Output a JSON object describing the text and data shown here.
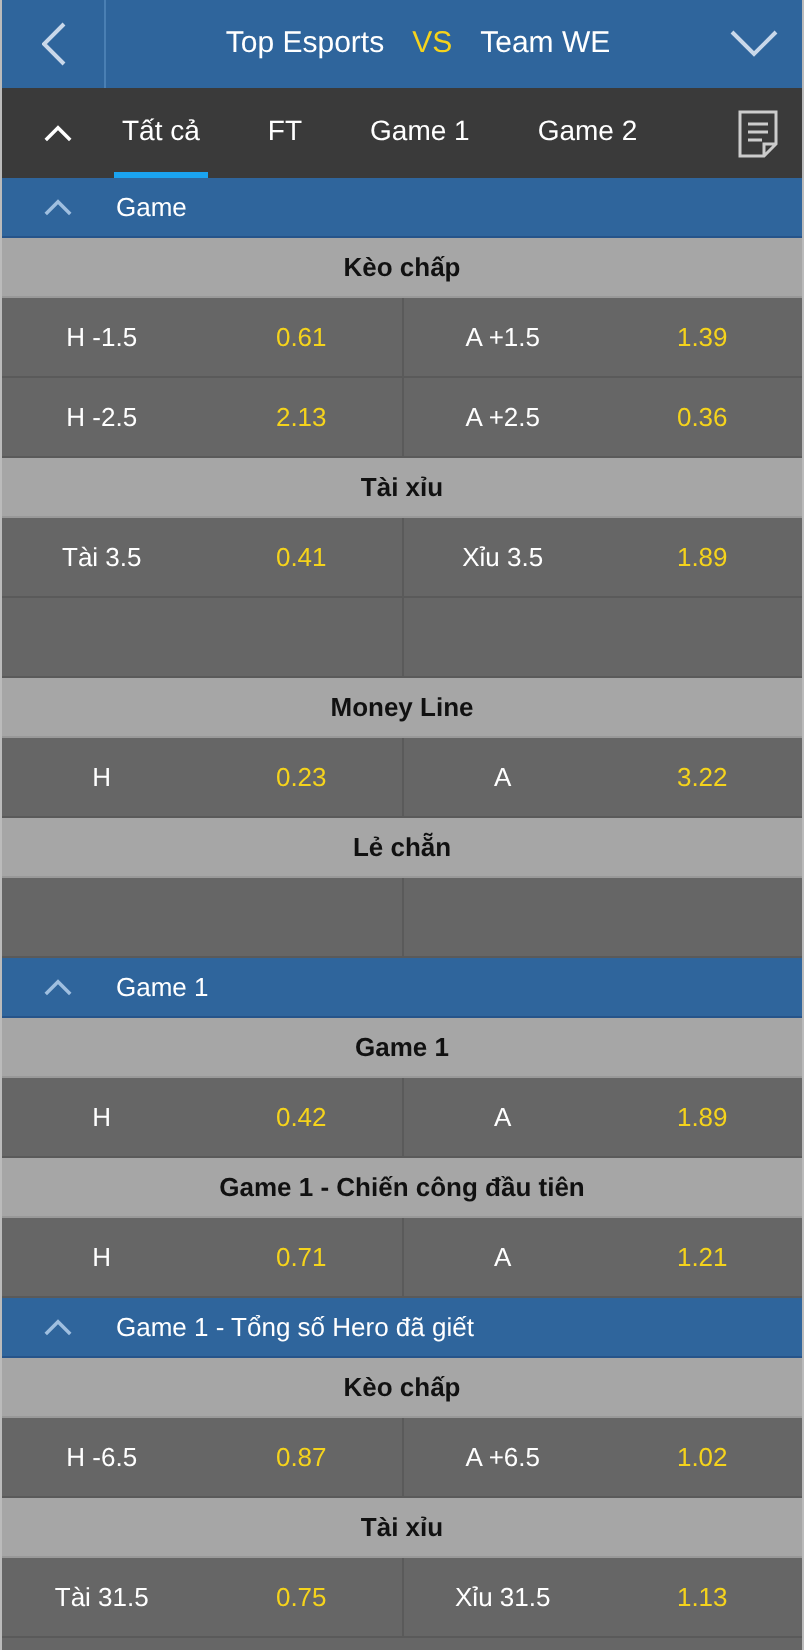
{
  "header": {
    "home": "Top Esports",
    "vs": "VS",
    "away": "Team WE"
  },
  "tabs": [
    {
      "label": "Tất cả",
      "selected": true
    },
    {
      "label": "FT",
      "selected": false
    },
    {
      "label": "Game 1",
      "selected": false
    },
    {
      "label": "Game 2",
      "selected": false
    }
  ],
  "sections": [
    {
      "title": "Game",
      "expanded": true,
      "markets": [
        {
          "title": "Kèo chấp",
          "rows": [
            {
              "kind": "odds",
              "home_label": "H -1.5",
              "home_odds": "0.61",
              "away_label": "A +1.5",
              "away_odds": "1.39"
            },
            {
              "kind": "odds",
              "home_label": "H -2.5",
              "home_odds": "2.13",
              "away_label": "A +2.5",
              "away_odds": "0.36"
            }
          ]
        },
        {
          "title": "Tài xỉu",
          "rows": [
            {
              "kind": "odds",
              "home_label": "Tài 3.5",
              "home_odds": "0.41",
              "away_label": "Xỉu 3.5",
              "away_odds": "1.89"
            },
            {
              "kind": "empty"
            }
          ]
        },
        {
          "title": "Money Line",
          "rows": [
            {
              "kind": "odds",
              "home_label": "H",
              "home_odds": "0.23",
              "away_label": "A",
              "away_odds": "3.22"
            }
          ]
        },
        {
          "title": "Lẻ chẵn",
          "rows": [
            {
              "kind": "empty"
            }
          ]
        }
      ]
    },
    {
      "title": "Game 1",
      "expanded": true,
      "markets": [
        {
          "title": "Game 1",
          "rows": [
            {
              "kind": "odds",
              "home_label": "H",
              "home_odds": "0.42",
              "away_label": "A",
              "away_odds": "1.89"
            }
          ]
        },
        {
          "title": "Game 1 - Chiến công đầu tiên",
          "rows": [
            {
              "kind": "odds",
              "home_label": "H",
              "home_odds": "0.71",
              "away_label": "A",
              "away_odds": "1.21"
            }
          ]
        }
      ]
    },
    {
      "title": "Game 1 - Tổng số Hero đã giết",
      "expanded": true,
      "markets": [
        {
          "title": "Kèo chấp",
          "rows": [
            {
              "kind": "odds",
              "home_label": "H -6.5",
              "home_odds": "0.87",
              "away_label": "A +6.5",
              "away_odds": "1.02"
            }
          ]
        },
        {
          "title": "Tài xỉu",
          "rows": [
            {
              "kind": "odds",
              "home_label": "Tài 31.5",
              "home_odds": "0.75",
              "away_label": "Xỉu 31.5",
              "away_odds": "1.13"
            }
          ]
        }
      ]
    }
  ]
}
